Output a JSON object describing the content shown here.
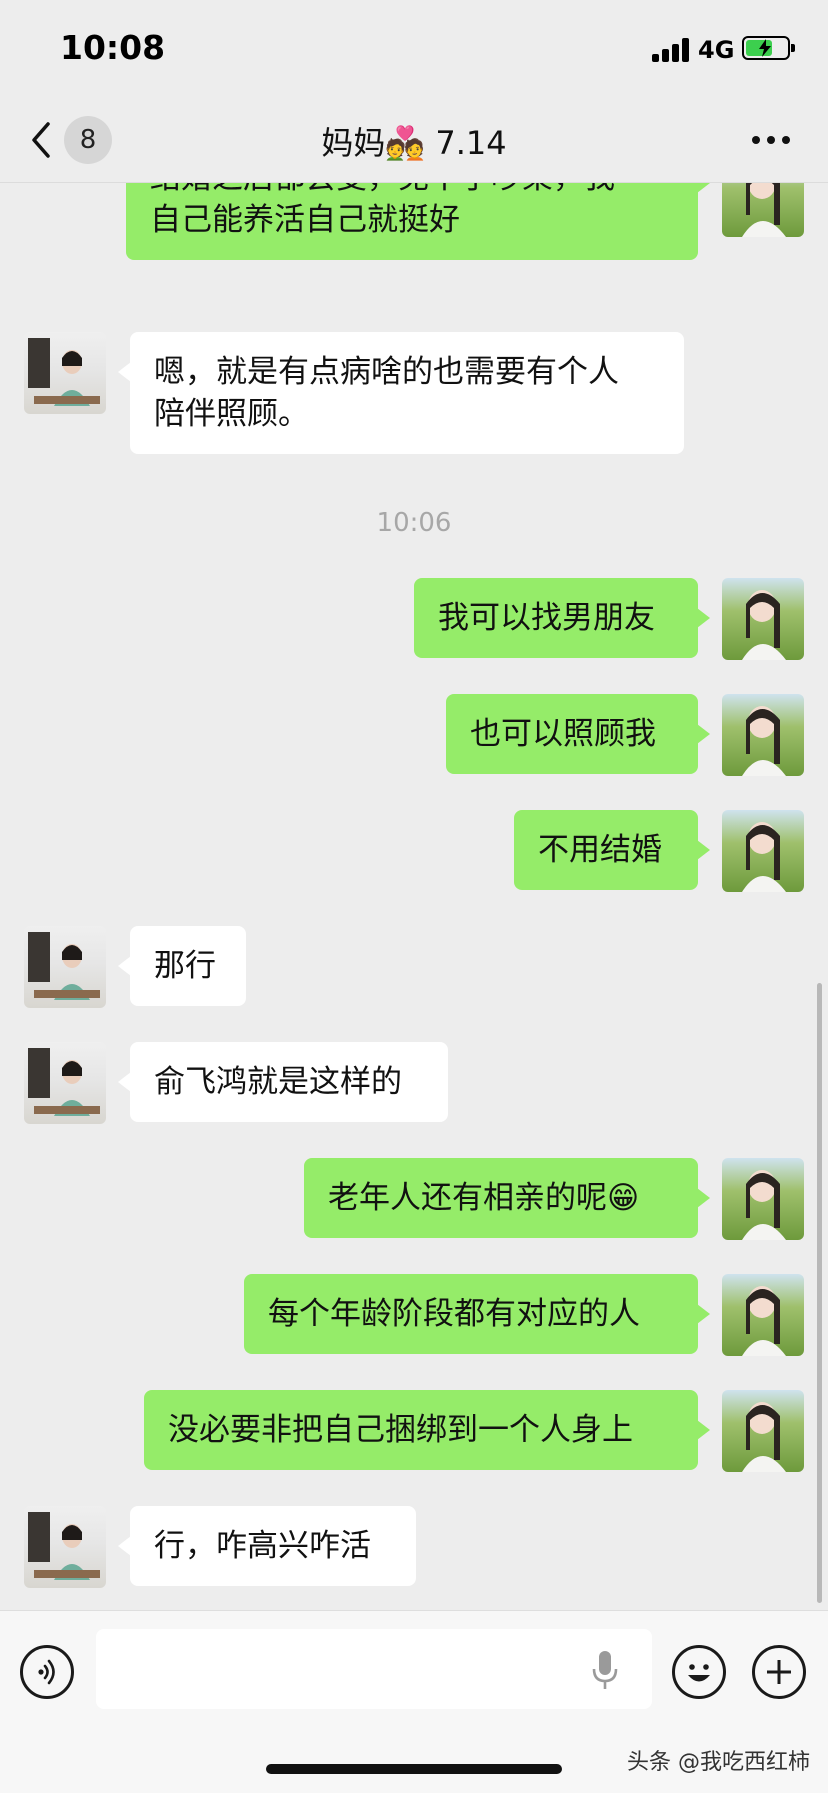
{
  "status_bar": {
    "time": "10:08",
    "network": "4G",
    "battery_color": "#3ccf4e"
  },
  "header": {
    "back_count": "8",
    "title": "妈妈💑 7.14"
  },
  "colors": {
    "outgoing_bubble": "#95ec69",
    "incoming_bubble": "#ffffff",
    "background": "#ededed"
  },
  "messages": [
    {
      "side": "out",
      "text": "因为这个世界上没有一些不变的男，结婚之后都会变，免不了吵架，我自己能养活自己就挺好",
      "visible_text": "结婚之后都会变，免不了吵架，我\n自己能养活自己就挺好"
    },
    {
      "side": "in",
      "text": "嗯，就是有点病啥的也需要有个人\n陪伴照顾。"
    },
    {
      "side": "out",
      "text": "我可以找男朋友"
    },
    {
      "side": "out",
      "text": "也可以照顾我"
    },
    {
      "side": "out",
      "text": "不用结婚"
    },
    {
      "side": "in",
      "text": "那行"
    },
    {
      "side": "in",
      "text": "俞飞鸿就是这样的"
    },
    {
      "side": "out",
      "text": "老年人还有相亲的呢😁"
    },
    {
      "side": "out",
      "text": "每个年龄阶段都有对应的人"
    },
    {
      "side": "out",
      "text": "没必要非把自己捆绑到一个人身上"
    },
    {
      "side": "in",
      "text": "行，咋高兴咋活"
    }
  ],
  "time_divider": "10:06",
  "input": {
    "placeholder": ""
  },
  "icons": [
    "back-icon",
    "more-icon",
    "voice-icon",
    "mic-icon",
    "emoji-icon",
    "plus-icon"
  ],
  "watermark": "头条 @我吃西红柿"
}
